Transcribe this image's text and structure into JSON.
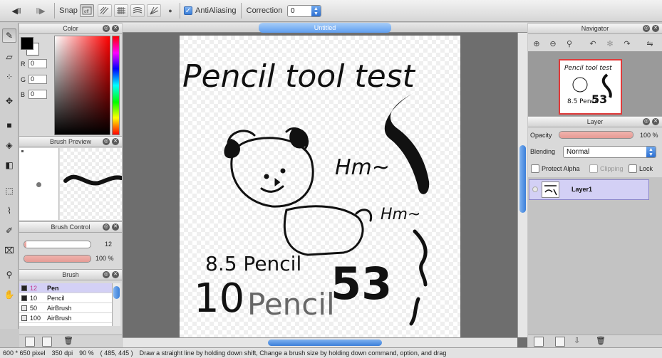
{
  "toolbar": {
    "snap_label": "Snap",
    "antialias_label": "AntiAliasing",
    "antialias_checked": true,
    "correction_label": "Correction",
    "correction_value": "0"
  },
  "document": {
    "title": "Untitled"
  },
  "color_panel": {
    "title": "Color",
    "r_label": "R",
    "r_value": "0",
    "g_label": "G",
    "g_value": "0",
    "b_label": "B",
    "b_value": "0",
    "foreground": "#000000",
    "background": "#ffffff"
  },
  "brush_preview": {
    "title": "Brush Preview"
  },
  "brush_control": {
    "title": "Brush Control",
    "size_value": "12",
    "opacity_value": "100 %"
  },
  "brush_panel": {
    "title": "Brush",
    "items": [
      {
        "size": "12",
        "name": "Pen",
        "selected": true,
        "swatch": "#222222"
      },
      {
        "size": "10",
        "name": "Pencil",
        "selected": false,
        "swatch": "#222222"
      },
      {
        "size": "50",
        "name": "AirBrush",
        "selected": false,
        "swatch": "#e6e6e6"
      },
      {
        "size": "100",
        "name": "AirBrush",
        "selected": false,
        "swatch": "#e6e6e6"
      }
    ]
  },
  "navigator": {
    "title": "Navigator"
  },
  "layer_panel": {
    "title": "Layer",
    "opacity_label": "Opacity",
    "opacity_value": "100 %",
    "blending_label": "Blending",
    "blending_value": "Normal",
    "protect_alpha_label": "Protect Alpha",
    "clipping_label": "Clipping",
    "lock_label": "Lock",
    "layers": [
      {
        "name": "Layer1"
      }
    ]
  },
  "canvas_text": {
    "line1": "Pencil tool test",
    "hmm1": "Hm~",
    "hmm2": "Hm~",
    "pencil85": "8.5 Pencil",
    "pencil10_num": "10",
    "pencil10_word": "Pencil",
    "big_num": "53"
  },
  "status": {
    "size": "600 * 650 pixel",
    "dpi": "350 dpi",
    "zoom": "90 %",
    "coords": "( 485, 445 )",
    "hint": "Draw a straight line by holding down shift, Change a brush size by holding down command, option, and drag"
  },
  "colors": {
    "accent": "#3b7fd9",
    "slider_fill": "#e59b95",
    "layer_selected": "#d3d0f5",
    "navigator_border": "#e03a3a",
    "workspace": "#6e6e6e"
  }
}
